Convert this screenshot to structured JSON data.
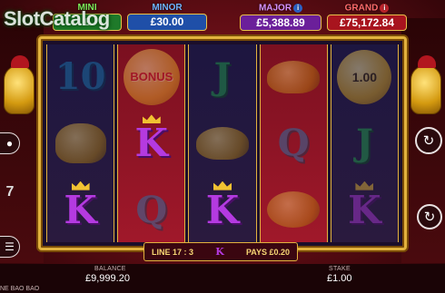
{
  "watermark": "SlotCatalog",
  "jackpots": {
    "mini": {
      "label": "MINI",
      "value": "£"
    },
    "minor": {
      "label": "MINOR",
      "value": "£30.00"
    },
    "major": {
      "label": "MAJOR",
      "value": "£5,388.89"
    },
    "grand": {
      "label": "GRAND",
      "value": "£75,172.84"
    }
  },
  "reels": [
    [
      {
        "symbol": "ten",
        "text": "10",
        "dim": true
      },
      {
        "symbol": "golden-lion",
        "text": "",
        "dim": true
      },
      {
        "symbol": "king",
        "text": "K",
        "dim": false
      }
    ],
    [
      {
        "symbol": "bonus-coin",
        "text": "BONUS",
        "dim": true
      },
      {
        "symbol": "king",
        "text": "K",
        "dim": false
      },
      {
        "symbol": "queen",
        "text": "Q",
        "dim": true
      }
    ],
    [
      {
        "symbol": "jack",
        "text": "J",
        "dim": true
      },
      {
        "symbol": "golden-turtle",
        "text": "",
        "dim": true
      },
      {
        "symbol": "king",
        "text": "K",
        "dim": false
      }
    ],
    [
      {
        "symbol": "golden-turtle",
        "text": "",
        "dim": true
      },
      {
        "symbol": "queen",
        "text": "Q",
        "dim": true
      },
      {
        "symbol": "golden-pig",
        "text": "",
        "dim": true
      }
    ],
    [
      {
        "symbol": "value-coin",
        "text": "1.00",
        "dim": true
      },
      {
        "symbol": "jack",
        "text": "J",
        "dim": true
      },
      {
        "symbol": "king",
        "text": "K",
        "dim": true
      }
    ]
  ],
  "win": {
    "line": "LINE 17 : 3",
    "symbol": "K",
    "pays": "PAYS £0.20"
  },
  "balance": {
    "label": "BALANCE",
    "value": "£9,999.20"
  },
  "stake": {
    "label": "STAKE",
    "value": "£1.00"
  },
  "game_name": "NE BAO BAO",
  "controls": {
    "spin_icon": "refresh-icon",
    "autoplay_icon": "autoplay-icon",
    "coins_icon": "coins-icon",
    "menu_icon": "menu-icon",
    "left_number": "7"
  },
  "colors": {
    "frame_gold": "#e2b23e",
    "king_purple": "#b43ae0",
    "queen_blue": "#1a7fb8",
    "jack_green": "#1fa84b"
  }
}
